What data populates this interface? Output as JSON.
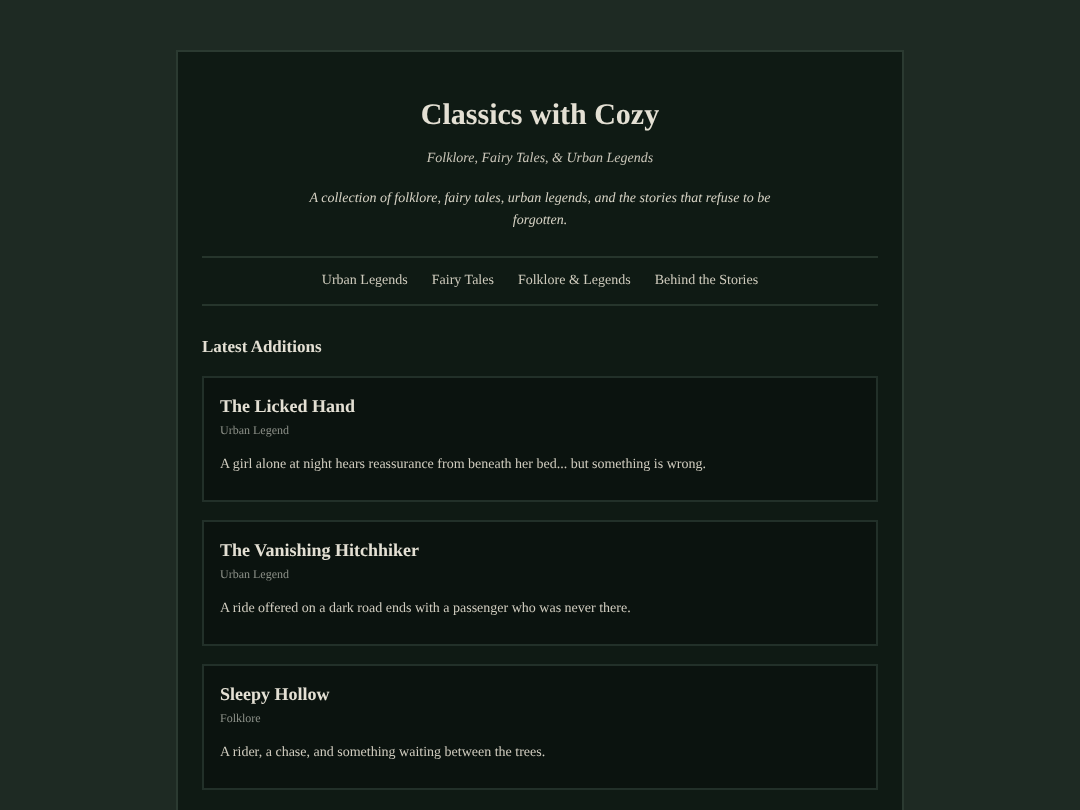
{
  "site": {
    "title": "Classics with Cozy",
    "tagline": "Folklore, Fairy Tales, & Urban Legends",
    "description": "A collection of folklore, fairy tales, urban legends, and the stories that refuse to be forgotten."
  },
  "nav": [
    {
      "label": "Urban Legends"
    },
    {
      "label": "Fairy Tales"
    },
    {
      "label": "Folklore & Legends"
    },
    {
      "label": "Behind the Stories"
    }
  ],
  "section_title": "Latest Additions",
  "stories": [
    {
      "title": "The Licked Hand",
      "category": "Urban Legend",
      "summary": "A girl alone at night hears reassurance from beneath her bed... but something is wrong."
    },
    {
      "title": "The Vanishing Hitchhiker",
      "category": "Urban Legend",
      "summary": "A ride offered on a dark road ends with a passenger who was never there."
    },
    {
      "title": "Sleepy Hollow",
      "category": "Folklore",
      "summary": "A rider, a chase, and something waiting between the trees."
    }
  ]
}
